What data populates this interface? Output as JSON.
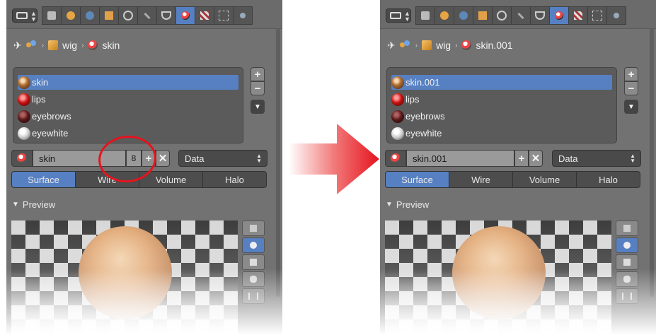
{
  "left_panel": {
    "breadcrumb": {
      "object_label": "wig",
      "material_label": "skin"
    },
    "materials": [
      {
        "name": "skin",
        "selected": true,
        "color": "#b06e33"
      },
      {
        "name": "lips",
        "selected": false,
        "color": "#cc1111"
      },
      {
        "name": "eyebrows",
        "selected": false,
        "color": "#5a1a1a"
      },
      {
        "name": "eyewhite",
        "selected": false,
        "color": "#dddddd"
      }
    ],
    "datablock": {
      "name": "skin",
      "users": "8",
      "link_select": "Data"
    },
    "tabs": [
      "Surface",
      "Wire",
      "Volume",
      "Halo"
    ],
    "preview_label": "Preview"
  },
  "right_panel": {
    "breadcrumb": {
      "object_label": "wig",
      "material_label": "skin.001"
    },
    "materials": [
      {
        "name": "skin.001",
        "selected": true,
        "color": "#b06e33"
      },
      {
        "name": "lips",
        "selected": false,
        "color": "#cc1111"
      },
      {
        "name": "eyebrows",
        "selected": false,
        "color": "#5a1a1a"
      },
      {
        "name": "eyewhite",
        "selected": false,
        "color": "#dddddd"
      }
    ],
    "datablock": {
      "name": "skin.001",
      "link_select": "Data"
    },
    "tabs": [
      "Surface",
      "Wire",
      "Volume",
      "Halo"
    ],
    "preview_label": "Preview"
  },
  "colors": {
    "accent": "#5680c2",
    "annotation": "#e4141e",
    "panel_bg": "#727272"
  }
}
